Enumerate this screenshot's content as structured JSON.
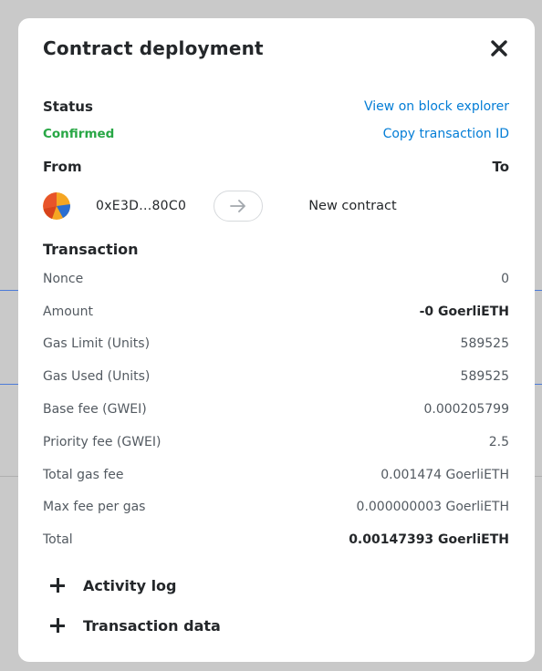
{
  "modal": {
    "title": "Contract deployment",
    "close_icon": "close-icon"
  },
  "status": {
    "label": "Status",
    "value": "Confirmed",
    "value_color": "#28a745",
    "view_explorer_link": "View on block explorer",
    "copy_tx_link": "Copy transaction ID",
    "link_color": "#037dd6"
  },
  "from_to": {
    "from_label": "From",
    "to_label": "To",
    "from_address": "0xE3D...80C0",
    "to_value": "New contract",
    "arrow_icon": "arrow-right-icon"
  },
  "transaction": {
    "title": "Transaction",
    "rows": [
      {
        "label": "Nonce",
        "value": "0"
      },
      {
        "label": "Amount",
        "value": "-0 GoerliETH"
      },
      {
        "label": "Gas Limit (Units)",
        "value": "589525"
      },
      {
        "label": "Gas Used (Units)",
        "value": "589525"
      },
      {
        "label": "Base fee (GWEI)",
        "value": "0.000205799"
      },
      {
        "label": "Priority fee (GWEI)",
        "value": "2.5"
      },
      {
        "label": "Total gas fee",
        "value": "0.001474 GoerliETH"
      },
      {
        "label": "Max fee per gas",
        "value": "0.000000003 GoerliETH"
      },
      {
        "label": "Total",
        "value": "0.00147393 GoerliETH"
      }
    ]
  },
  "expanders": {
    "activity_log": "Activity log",
    "transaction_data": "Transaction data"
  }
}
